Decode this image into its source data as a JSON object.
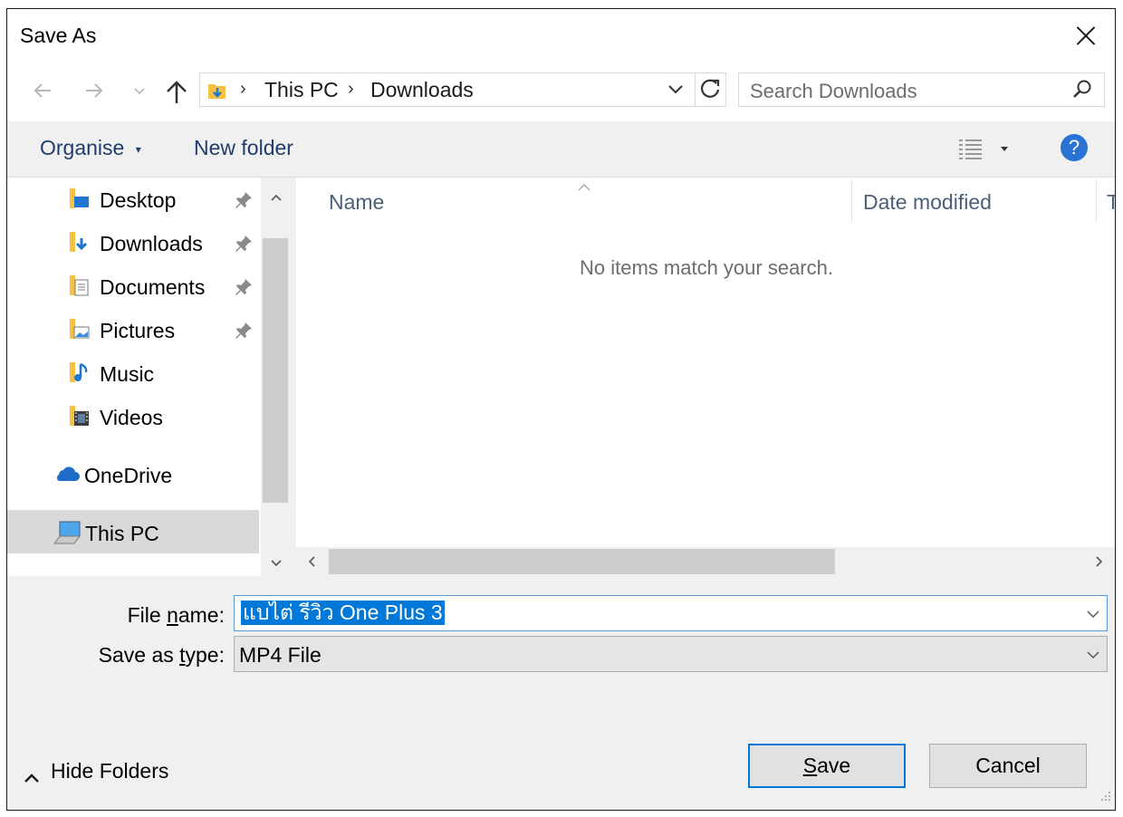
{
  "window": {
    "title": "Save As"
  },
  "navbar": {
    "breadcrumb": [
      "This PC",
      "Downloads"
    ],
    "search_placeholder": "Search Downloads"
  },
  "toolbar": {
    "organise_label": "Organise",
    "new_folder_label": "New folder"
  },
  "sidebar": {
    "items": [
      {
        "label": "Desktop",
        "icon": "desktop-folder-icon",
        "pinned": true
      },
      {
        "label": "Downloads",
        "icon": "downloads-folder-icon",
        "pinned": true
      },
      {
        "label": "Documents",
        "icon": "documents-folder-icon",
        "pinned": true
      },
      {
        "label": "Pictures",
        "icon": "pictures-folder-icon",
        "pinned": true
      },
      {
        "label": "Music",
        "icon": "music-folder-icon",
        "pinned": false
      },
      {
        "label": "Videos",
        "icon": "videos-folder-icon",
        "pinned": false
      },
      {
        "label": "OneDrive",
        "icon": "onedrive-cloud-icon",
        "pinned": false
      },
      {
        "label": "This PC",
        "icon": "this-pc-icon",
        "pinned": false,
        "selected": true
      }
    ]
  },
  "filelist": {
    "columns": [
      "Name",
      "Date modified",
      "T"
    ],
    "empty_message": "No items match your search."
  },
  "form": {
    "filename_label_pre": "File ",
    "filename_label_u": "n",
    "filename_label_post": "ame:",
    "filename_value": "แบไต่ รีวิว One Plus 3",
    "savetype_label_pre": "Save as ",
    "savetype_label_u": "t",
    "savetype_label_post": "ype:",
    "savetype_value": "MP4 File"
  },
  "footer": {
    "hide_folders_label": "Hide Folders",
    "save_label_u": "S",
    "save_label_rest": "ave",
    "cancel_label": "Cancel"
  },
  "colors": {
    "accent": "#0078d7",
    "help": "#2a72d3",
    "folder": "#f5c242"
  }
}
